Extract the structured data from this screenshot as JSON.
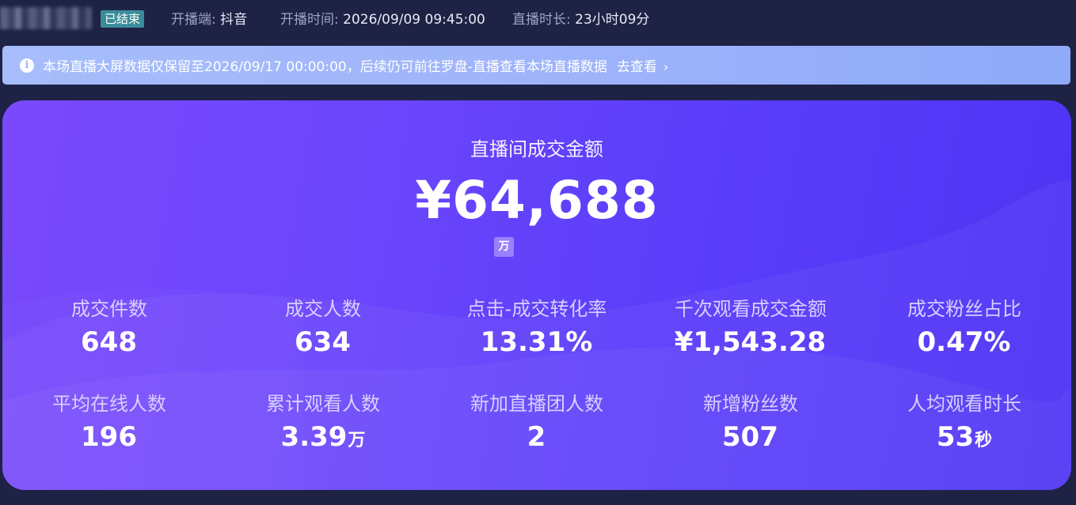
{
  "header": {
    "room_name": "",
    "status": "已结束",
    "platform_label": "开播端:",
    "platform_value": "抖音",
    "start_time_label": "开播时间:",
    "start_time_value": "2026/09/09 09:45:00",
    "duration_label": "直播时长:",
    "duration_value": "23小时09分"
  },
  "notice": {
    "icon": "info-icon",
    "text": "本场直播大屏数据仅保留至2026/09/17 00:00:00，后续仍可前往罗盘-直播查看本场直播数据",
    "link_label": "去查看",
    "link_icon": "chevron-right-icon"
  },
  "summary": {
    "title": "直播间成交金额",
    "amount": "¥64,688",
    "unit_toggle": "万"
  },
  "metrics": [
    {
      "label": "成交件数",
      "value": "648",
      "unit": ""
    },
    {
      "label": "成交人数",
      "value": "634",
      "unit": ""
    },
    {
      "label": "点击-成交转化率",
      "value": "13.31%",
      "unit": ""
    },
    {
      "label": "千次观看成交金额",
      "value": "¥1,543.28",
      "unit": ""
    },
    {
      "label": "成交粉丝占比",
      "value": "0.47%",
      "unit": ""
    },
    {
      "label": "平均在线人数",
      "value": "196",
      "unit": ""
    },
    {
      "label": "累计观看人数",
      "value": "3.39",
      "unit": "万"
    },
    {
      "label": "新加直播团人数",
      "value": "2",
      "unit": ""
    },
    {
      "label": "新增粉丝数",
      "value": "507",
      "unit": ""
    },
    {
      "label": "人均观看时长",
      "value": "53",
      "unit": "秒"
    }
  ],
  "colors": {
    "page_background": "#1e2345",
    "status_badge": "#3b8c9a",
    "notice_background": "#9fb4fa",
    "card_gradient_start": "#7a49fb",
    "card_gradient_end": "#4e33f4"
  }
}
